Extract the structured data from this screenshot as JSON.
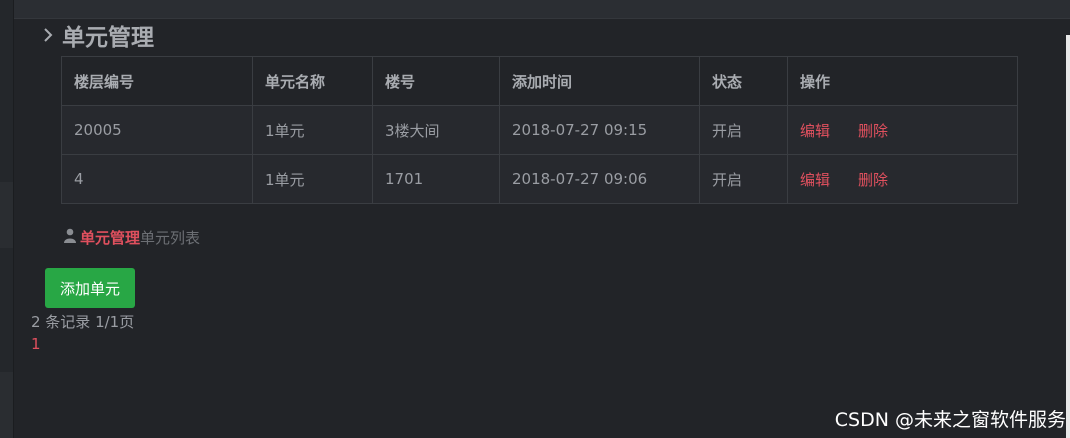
{
  "page": {
    "title": "单元管理"
  },
  "table": {
    "headers": [
      "楼层编号",
      "单元名称",
      "楼号",
      "添加时间",
      "状态",
      "操作"
    ],
    "rows": [
      {
        "floor_no": "20005",
        "unit_name": "1单元",
        "building": "3楼大间",
        "added": "2018-07-27 09:15",
        "status": "开启",
        "edit": "编辑",
        "delete": "删除"
      },
      {
        "floor_no": "4",
        "unit_name": "1单元",
        "building": "1701",
        "added": "2018-07-27 09:06",
        "status": "开启",
        "edit": "编辑",
        "delete": "删除"
      }
    ]
  },
  "breadcrumb": {
    "active": "单元管理",
    "current": "单元列表",
    "icon": "user-icon"
  },
  "actions": {
    "add_label": "添加单元"
  },
  "pagination": {
    "summary": "2 条记录 1/1页",
    "current_page": "1"
  },
  "watermark": "CSDN @未来之窗软件服务",
  "colors": {
    "background": "#222428",
    "link_red": "#e0505e",
    "button_green": "#28a745"
  }
}
